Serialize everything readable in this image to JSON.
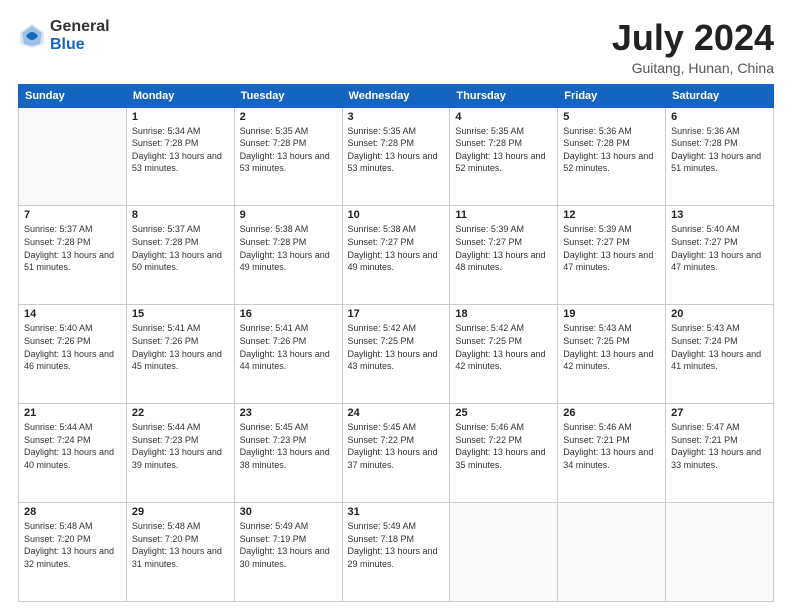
{
  "logo": {
    "general": "General",
    "blue": "Blue"
  },
  "title": "July 2024",
  "subtitle": "Guitang, Hunan, China",
  "headers": [
    "Sunday",
    "Monday",
    "Tuesday",
    "Wednesday",
    "Thursday",
    "Friday",
    "Saturday"
  ],
  "weeks": [
    [
      {
        "day": "",
        "sunrise": "",
        "sunset": "",
        "daylight": ""
      },
      {
        "day": "1",
        "sunrise": "Sunrise: 5:34 AM",
        "sunset": "Sunset: 7:28 PM",
        "daylight": "Daylight: 13 hours and 53 minutes."
      },
      {
        "day": "2",
        "sunrise": "Sunrise: 5:35 AM",
        "sunset": "Sunset: 7:28 PM",
        "daylight": "Daylight: 13 hours and 53 minutes."
      },
      {
        "day": "3",
        "sunrise": "Sunrise: 5:35 AM",
        "sunset": "Sunset: 7:28 PM",
        "daylight": "Daylight: 13 hours and 53 minutes."
      },
      {
        "day": "4",
        "sunrise": "Sunrise: 5:35 AM",
        "sunset": "Sunset: 7:28 PM",
        "daylight": "Daylight: 13 hours and 52 minutes."
      },
      {
        "day": "5",
        "sunrise": "Sunrise: 5:36 AM",
        "sunset": "Sunset: 7:28 PM",
        "daylight": "Daylight: 13 hours and 52 minutes."
      },
      {
        "day": "6",
        "sunrise": "Sunrise: 5:36 AM",
        "sunset": "Sunset: 7:28 PM",
        "daylight": "Daylight: 13 hours and 51 minutes."
      }
    ],
    [
      {
        "day": "7",
        "sunrise": "Sunrise: 5:37 AM",
        "sunset": "Sunset: 7:28 PM",
        "daylight": "Daylight: 13 hours and 51 minutes."
      },
      {
        "day": "8",
        "sunrise": "Sunrise: 5:37 AM",
        "sunset": "Sunset: 7:28 PM",
        "daylight": "Daylight: 13 hours and 50 minutes."
      },
      {
        "day": "9",
        "sunrise": "Sunrise: 5:38 AM",
        "sunset": "Sunset: 7:28 PM",
        "daylight": "Daylight: 13 hours and 49 minutes."
      },
      {
        "day": "10",
        "sunrise": "Sunrise: 5:38 AM",
        "sunset": "Sunset: 7:27 PM",
        "daylight": "Daylight: 13 hours and 49 minutes."
      },
      {
        "day": "11",
        "sunrise": "Sunrise: 5:39 AM",
        "sunset": "Sunset: 7:27 PM",
        "daylight": "Daylight: 13 hours and 48 minutes."
      },
      {
        "day": "12",
        "sunrise": "Sunrise: 5:39 AM",
        "sunset": "Sunset: 7:27 PM",
        "daylight": "Daylight: 13 hours and 47 minutes."
      },
      {
        "day": "13",
        "sunrise": "Sunrise: 5:40 AM",
        "sunset": "Sunset: 7:27 PM",
        "daylight": "Daylight: 13 hours and 47 minutes."
      }
    ],
    [
      {
        "day": "14",
        "sunrise": "Sunrise: 5:40 AM",
        "sunset": "Sunset: 7:26 PM",
        "daylight": "Daylight: 13 hours and 46 minutes."
      },
      {
        "day": "15",
        "sunrise": "Sunrise: 5:41 AM",
        "sunset": "Sunset: 7:26 PM",
        "daylight": "Daylight: 13 hours and 45 minutes."
      },
      {
        "day": "16",
        "sunrise": "Sunrise: 5:41 AM",
        "sunset": "Sunset: 7:26 PM",
        "daylight": "Daylight: 13 hours and 44 minutes."
      },
      {
        "day": "17",
        "sunrise": "Sunrise: 5:42 AM",
        "sunset": "Sunset: 7:25 PM",
        "daylight": "Daylight: 13 hours and 43 minutes."
      },
      {
        "day": "18",
        "sunrise": "Sunrise: 5:42 AM",
        "sunset": "Sunset: 7:25 PM",
        "daylight": "Daylight: 13 hours and 42 minutes."
      },
      {
        "day": "19",
        "sunrise": "Sunrise: 5:43 AM",
        "sunset": "Sunset: 7:25 PM",
        "daylight": "Daylight: 13 hours and 42 minutes."
      },
      {
        "day": "20",
        "sunrise": "Sunrise: 5:43 AM",
        "sunset": "Sunset: 7:24 PM",
        "daylight": "Daylight: 13 hours and 41 minutes."
      }
    ],
    [
      {
        "day": "21",
        "sunrise": "Sunrise: 5:44 AM",
        "sunset": "Sunset: 7:24 PM",
        "daylight": "Daylight: 13 hours and 40 minutes."
      },
      {
        "day": "22",
        "sunrise": "Sunrise: 5:44 AM",
        "sunset": "Sunset: 7:23 PM",
        "daylight": "Daylight: 13 hours and 39 minutes."
      },
      {
        "day": "23",
        "sunrise": "Sunrise: 5:45 AM",
        "sunset": "Sunset: 7:23 PM",
        "daylight": "Daylight: 13 hours and 38 minutes."
      },
      {
        "day": "24",
        "sunrise": "Sunrise: 5:45 AM",
        "sunset": "Sunset: 7:22 PM",
        "daylight": "Daylight: 13 hours and 37 minutes."
      },
      {
        "day": "25",
        "sunrise": "Sunrise: 5:46 AM",
        "sunset": "Sunset: 7:22 PM",
        "daylight": "Daylight: 13 hours and 35 minutes."
      },
      {
        "day": "26",
        "sunrise": "Sunrise: 5:46 AM",
        "sunset": "Sunset: 7:21 PM",
        "daylight": "Daylight: 13 hours and 34 minutes."
      },
      {
        "day": "27",
        "sunrise": "Sunrise: 5:47 AM",
        "sunset": "Sunset: 7:21 PM",
        "daylight": "Daylight: 13 hours and 33 minutes."
      }
    ],
    [
      {
        "day": "28",
        "sunrise": "Sunrise: 5:48 AM",
        "sunset": "Sunset: 7:20 PM",
        "daylight": "Daylight: 13 hours and 32 minutes."
      },
      {
        "day": "29",
        "sunrise": "Sunrise: 5:48 AM",
        "sunset": "Sunset: 7:20 PM",
        "daylight": "Daylight: 13 hours and 31 minutes."
      },
      {
        "day": "30",
        "sunrise": "Sunrise: 5:49 AM",
        "sunset": "Sunset: 7:19 PM",
        "daylight": "Daylight: 13 hours and 30 minutes."
      },
      {
        "day": "31",
        "sunrise": "Sunrise: 5:49 AM",
        "sunset": "Sunset: 7:18 PM",
        "daylight": "Daylight: 13 hours and 29 minutes."
      },
      {
        "day": "",
        "sunrise": "",
        "sunset": "",
        "daylight": ""
      },
      {
        "day": "",
        "sunrise": "",
        "sunset": "",
        "daylight": ""
      },
      {
        "day": "",
        "sunrise": "",
        "sunset": "",
        "daylight": ""
      }
    ]
  ]
}
